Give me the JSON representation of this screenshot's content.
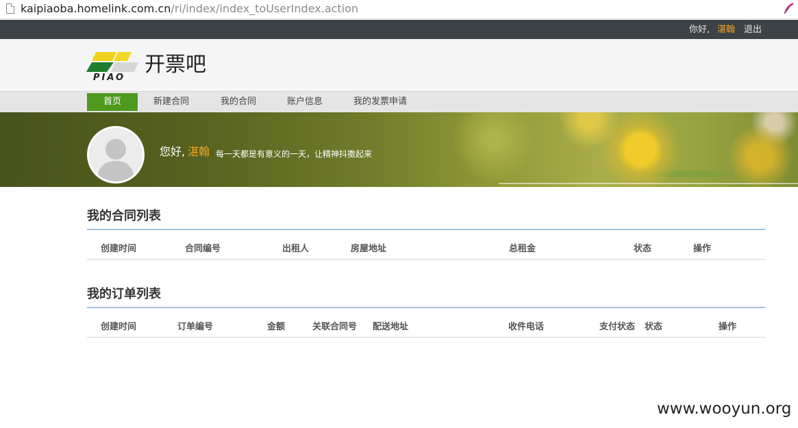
{
  "browser": {
    "url_host": "kaipiaoba.homelink.com.cn",
    "url_path": "/ri/index/index_toUserIndex.action"
  },
  "topbar": {
    "greeting": "你好,",
    "username": "湛翰",
    "logout": "退出"
  },
  "header": {
    "logo_text": "开票吧",
    "logo_sub": "PIAO"
  },
  "nav": {
    "items": [
      "首页",
      "新建合同",
      "我的合同",
      "账户信息",
      "我的发票申请"
    ],
    "active_index": 0
  },
  "banner": {
    "hello": "您好,",
    "username": "湛翰",
    "motto": "每一天都是有意义的一天，让精神抖擞起来"
  },
  "contracts": {
    "title": "我的合同列表",
    "columns": [
      "创建时间",
      "合同编号",
      "出租人",
      "房屋地址",
      "总租金",
      "状态",
      "操作"
    ]
  },
  "orders": {
    "title": "我的订单列表",
    "columns": [
      "创建时间",
      "订单编号",
      "金额",
      "关联合同号",
      "配送地址",
      "收件电话",
      "支付状态",
      "状态",
      "操作"
    ]
  },
  "watermark": "www.wooyun.org",
  "colors": {
    "accent_green": "#4f9a1e",
    "username_orange": "#f5a623",
    "topbar_bg": "#3c4245",
    "section_rule": "#a7c1de"
  }
}
